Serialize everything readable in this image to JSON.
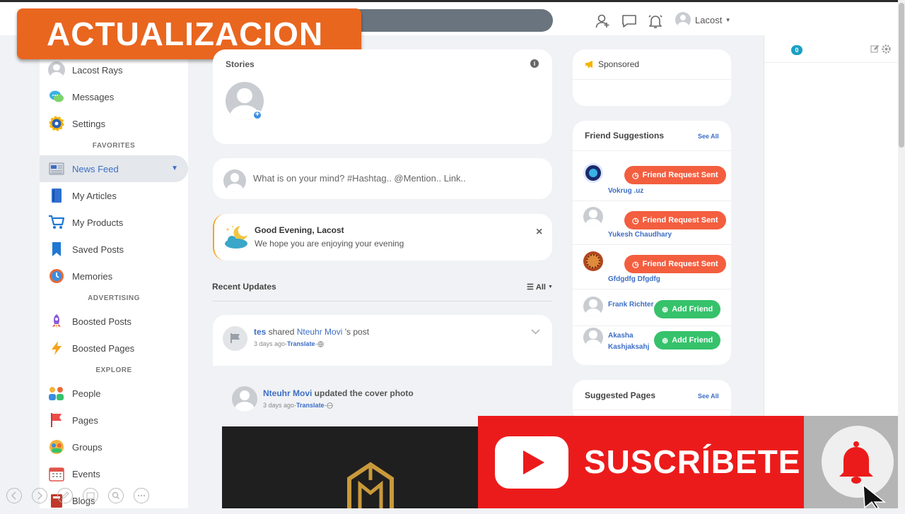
{
  "banner": {
    "text": "ACTUALIZACION"
  },
  "topbar": {
    "username": "Lacost",
    "caret": "▾"
  },
  "left_nav": {
    "profile": "Lacost Rays",
    "messages": "Messages",
    "settings": "Settings",
    "favorites_header": "FAVORITES",
    "news_feed": "News Feed",
    "my_articles": "My Articles",
    "my_products": "My Products",
    "saved_posts": "Saved Posts",
    "memories": "Memories",
    "advertising_header": "ADVERTISING",
    "boosted_posts": "Boosted Posts",
    "boosted_pages": "Boosted Pages",
    "explore_header": "EXPLORE",
    "people": "People",
    "pages": "Pages",
    "groups": "Groups",
    "events": "Events",
    "blogs": "Blogs"
  },
  "stories": {
    "title": "Stories",
    "info": "i"
  },
  "composer": {
    "placeholder": "What is on your mind? #Hashtag.. @Mention.. Link.."
  },
  "greeting": {
    "title": "Good Evening, Lacost",
    "subtitle": "We hope you are enjoying your evening",
    "close": "×"
  },
  "recent": {
    "title": "Recent Updates",
    "filter": "All",
    "filter_icon": "☰"
  },
  "post": {
    "author": "tes",
    "action": " shared ",
    "target": "Nteuhr Movi",
    "target_suffix": " 's post",
    "time": "3 days ago",
    "sep": " - ",
    "translate": "Translate",
    "inner_author": "Nteuhr Movi",
    "inner_action": " updated the cover photo",
    "inner_time": "3 days ago"
  },
  "sponsored": {
    "title": "Sponsored"
  },
  "friend_suggestions": {
    "title": "Friend Suggestions",
    "see_all": "See All",
    "items": [
      {
        "name": "Vokrug .uz",
        "name2": "",
        "button": "Friend Request Sent",
        "type": "sent"
      },
      {
        "name": "Yukesh Chaudhary",
        "name2": "",
        "button": "Friend Request Sent",
        "type": "sent"
      },
      {
        "name": "Gfdgdfg Dfgdfg",
        "name2": "",
        "button": "Friend Request Sent",
        "type": "sent"
      },
      {
        "name": "Frank Richter",
        "name2": "",
        "button": "Add Friend",
        "type": "add"
      },
      {
        "name": "Akasha",
        "name2": "Kashjaksahj",
        "button": "Add Friend",
        "type": "add"
      }
    ]
  },
  "suggested_pages": {
    "title": "Suggested Pages",
    "see_all": "See All"
  },
  "chat_panel": {
    "count": "0"
  },
  "youtube": {
    "label": "SUSCRÍBETE"
  },
  "colors": {
    "accent": "#3d6ec5",
    "orange": "#e9661f",
    "red_button": "#f35e3f",
    "green_button": "#36c26b",
    "youtube": "#ec1b1b"
  }
}
